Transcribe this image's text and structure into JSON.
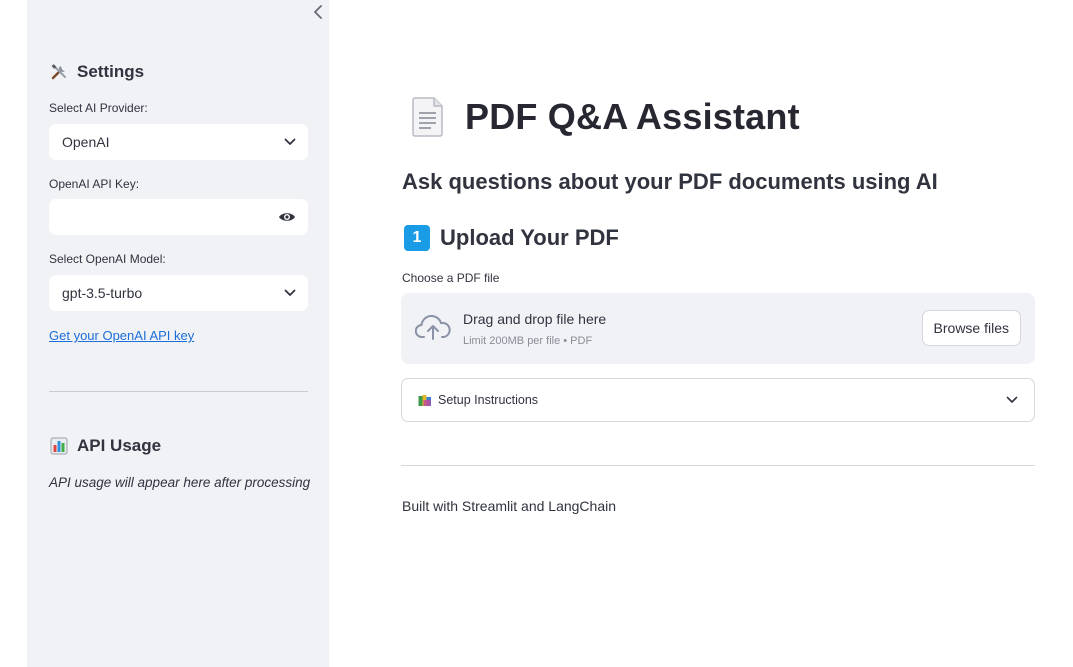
{
  "sidebar": {
    "collapse_icon": "chevron-left-icon",
    "settings_title": "Settings",
    "settings_icon": "tools-icon",
    "provider_label": "Select AI Provider:",
    "provider_value": "OpenAI",
    "api_key_label": "OpenAI API Key:",
    "api_key_value": "",
    "model_label": "Select OpenAI Model:",
    "model_value": "gpt-3.5-turbo",
    "api_key_link": "Get your OpenAI API key",
    "usage_title": "API Usage",
    "usage_icon": "bar-chart-icon",
    "usage_text": "API usage will appear here after processing"
  },
  "main": {
    "title": "PDF Q&A Assistant",
    "title_icon": "document-icon",
    "subtitle": "Ask questions about your PDF documents using AI",
    "upload_number": "1",
    "upload_heading": "Upload Your PDF",
    "file_label": "Choose a PDF file",
    "dropzone_title": "Drag and drop file here",
    "dropzone_limit": "Limit 200MB per file • PDF",
    "browse_label": "Browse files",
    "expander_label": "Setup Instructions",
    "expander_icon": "books-icon",
    "footer": "Built with Streamlit and LangChain"
  },
  "colors": {
    "sidebar_bg": "#f0f2f6",
    "link": "#1c6ed8",
    "badge": "#1a9be6"
  }
}
